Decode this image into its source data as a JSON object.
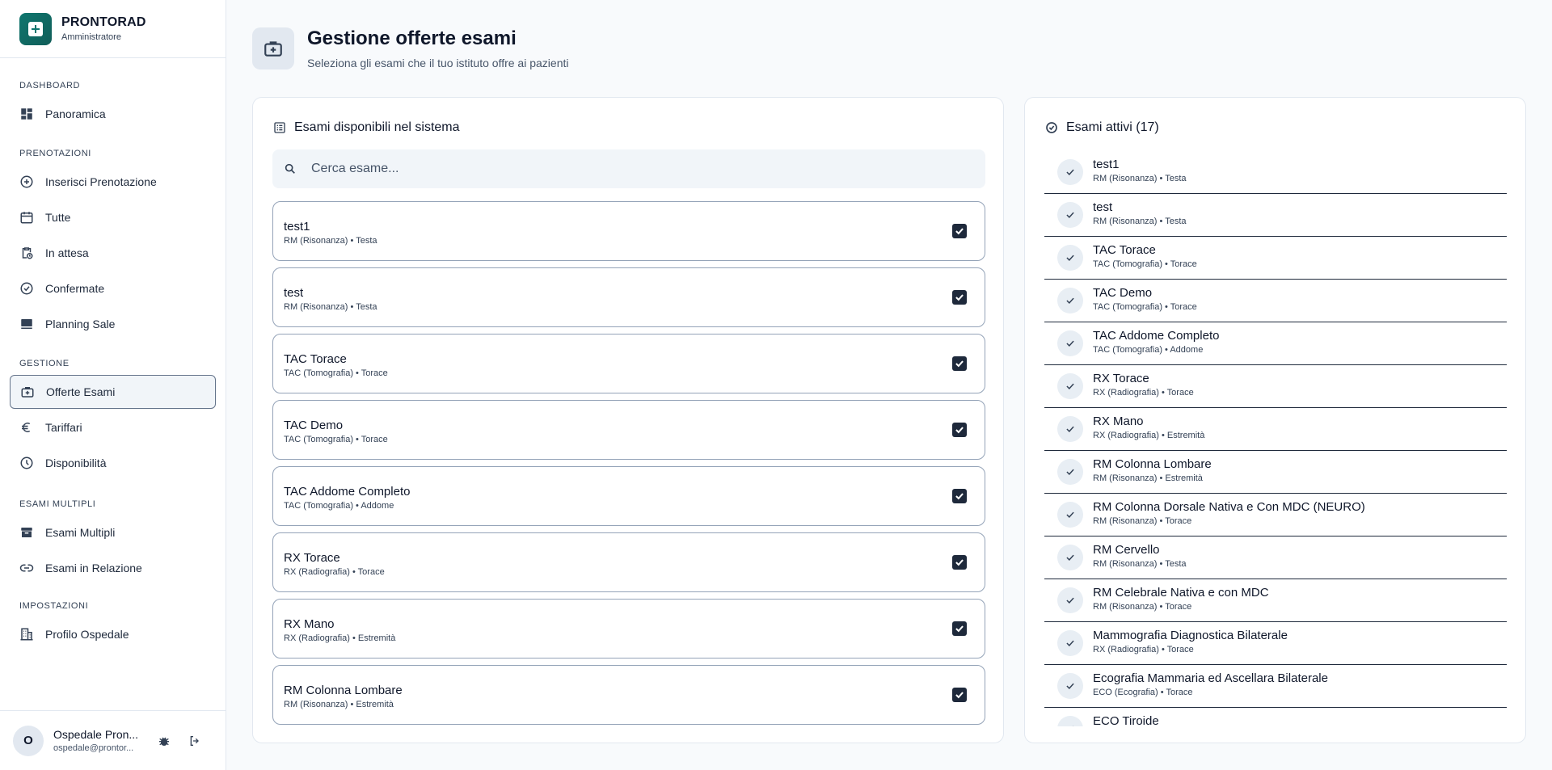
{
  "brand": {
    "name": "PRONTORAD",
    "role": "Amministratore"
  },
  "sidebar": {
    "sections": [
      {
        "title": "DASHBOARD",
        "items": [
          {
            "label": "Panoramica",
            "icon": "dashboard-icon"
          }
        ]
      },
      {
        "title": "PRENOTAZIONI",
        "items": [
          {
            "label": "Inserisci Prenotazione",
            "icon": "plus-circle-icon"
          },
          {
            "label": "Tutte",
            "icon": "calendar-icon"
          },
          {
            "label": "In attesa",
            "icon": "clipboard-clock-icon"
          },
          {
            "label": "Confermate",
            "icon": "check-circle-icon"
          },
          {
            "label": "Planning Sale",
            "icon": "monitor-icon"
          }
        ]
      },
      {
        "title": "GESTIONE",
        "items": [
          {
            "label": "Offerte Esami",
            "icon": "medical-briefcase-icon",
            "active": true
          },
          {
            "label": "Tariffari",
            "icon": "euro-icon"
          },
          {
            "label": "Disponibilità",
            "icon": "clock-icon"
          }
        ]
      },
      {
        "title": "ESAMI MULTIPLI",
        "items": [
          {
            "label": "Esami Multipli",
            "icon": "archive-icon"
          },
          {
            "label": "Esami in Relazione",
            "icon": "link-icon"
          }
        ]
      },
      {
        "title": "IMPOSTAZIONI",
        "items": [
          {
            "label": "Profilo Ospedale",
            "icon": "building-icon"
          }
        ]
      }
    ]
  },
  "user": {
    "initial": "O",
    "name": "Ospedale Pron...",
    "email": "ospedale@prontor..."
  },
  "header": {
    "title": "Gestione offerte esami",
    "subtitle": "Seleziona gli esami che il tuo istituto offre ai pazienti"
  },
  "available": {
    "title": "Esami disponibili nel sistema",
    "search_placeholder": "Cerca esame...",
    "items": [
      {
        "name": "test1",
        "meta": "RM (Risonanza) • Testa",
        "checked": true
      },
      {
        "name": "test",
        "meta": "RM (Risonanza) • Testa",
        "checked": true
      },
      {
        "name": "TAC Torace",
        "meta": "TAC (Tomografia) • Torace",
        "checked": true
      },
      {
        "name": "TAC Demo",
        "meta": "TAC (Tomografia) • Torace",
        "checked": true
      },
      {
        "name": "TAC Addome Completo",
        "meta": "TAC (Tomografia) • Addome",
        "checked": true
      },
      {
        "name": "RX Torace",
        "meta": "RX (Radiografia) • Torace",
        "checked": true
      },
      {
        "name": "RX Mano",
        "meta": "RX (Radiografia) • Estremità",
        "checked": true
      },
      {
        "name": "RM Colonna Lombare",
        "meta": "RM (Risonanza) • Estremità",
        "checked": true
      }
    ]
  },
  "active": {
    "title": "Esami attivi (17)",
    "items": [
      {
        "name": "test1",
        "meta": "RM (Risonanza) • Testa"
      },
      {
        "name": "test",
        "meta": "RM (Risonanza) • Testa"
      },
      {
        "name": "TAC Torace",
        "meta": "TAC (Tomografia) • Torace"
      },
      {
        "name": "TAC Demo",
        "meta": "TAC (Tomografia) • Torace"
      },
      {
        "name": "TAC Addome Completo",
        "meta": "TAC (Tomografia) • Addome"
      },
      {
        "name": "RX Torace",
        "meta": "RX (Radiografia) • Torace"
      },
      {
        "name": "RX Mano",
        "meta": "RX (Radiografia) • Estremità"
      },
      {
        "name": "RM Colonna Lombare",
        "meta": "RM (Risonanza) • Estremità"
      },
      {
        "name": "RM Colonna Dorsale Nativa e Con MDC (NEURO)",
        "meta": "RM (Risonanza) • Torace"
      },
      {
        "name": "RM Cervello",
        "meta": "RM (Risonanza) • Testa"
      },
      {
        "name": "RM Celebrale Nativa e con MDC",
        "meta": "RM (Risonanza) • Torace"
      },
      {
        "name": "Mammografia Diagnostica Bilaterale",
        "meta": "RX (Radiografia) • Torace"
      },
      {
        "name": "Ecografia Mammaria ed Ascellara Bilaterale",
        "meta": "ECO (Ecografia) • Torace"
      },
      {
        "name": "ECO Tiroide",
        "meta": ""
      }
    ]
  },
  "colors": {
    "accent": "#0f766e",
    "checkbox": "#1e293b",
    "background": "#f8fafc"
  }
}
